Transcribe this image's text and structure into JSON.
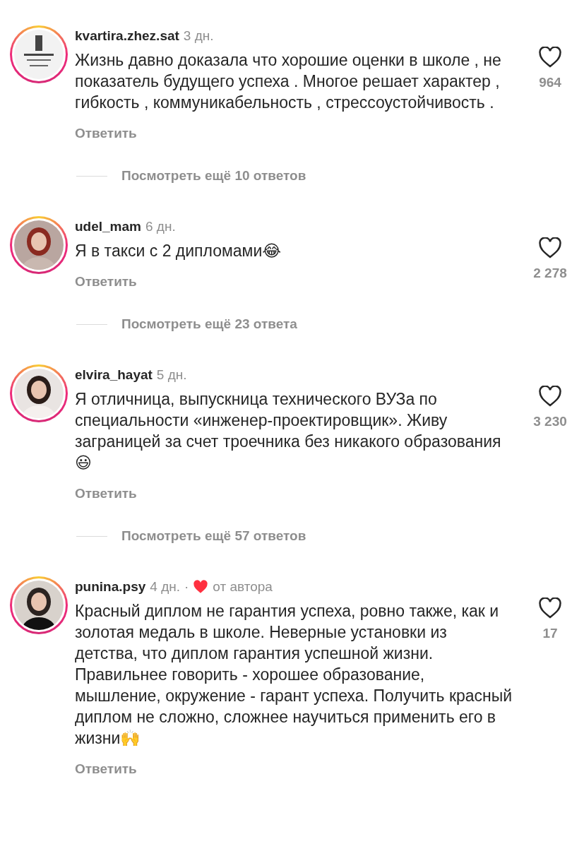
{
  "comments": [
    {
      "username": "kvartira.zhez.sat",
      "time": "3 дн.",
      "text": "Жизнь давно доказала что хорошие оценки в школе , не показатель будущего успеха . Многое решает характер , гибкость , коммуникабельность , стрессоустойчивость .",
      "liked": false,
      "likes": "964",
      "reply": "Ответить",
      "more_replies": "Посмотреть ещё 10 ответов"
    },
    {
      "username": "udel_mam",
      "time": "6 дн.",
      "text": "Я в такси с 2 дипломами😂",
      "liked": false,
      "likes": "2 278",
      "reply": "Ответить",
      "more_replies": "Посмотреть ещё 23 ответа"
    },
    {
      "username": "elvira_hayat",
      "time": "5 дн.",
      "text": "Я отличница, выпускница технического ВУЗа по специальности «инженер-проектировщик». Живу заграницей за счет троечника без никакого образования 😃",
      "liked": false,
      "likes": "3 230",
      "reply": "Ответить",
      "more_replies": "Посмотреть ещё 57 ответов"
    },
    {
      "username": "punina.psy",
      "time": "4 дн.",
      "separator": "·",
      "author_like": "от автора",
      "text": "Красный диплом не гарантия успеха, ровно также, как и золотая медаль в школе. Неверные установки из детства, что диплом гарантия успешной жизни. Правильнее говорить - хорошее образование, мышление, окружение - гарант успеха. Получить красный диплом не сложно, сложнее научиться применить его в жизни🙌",
      "liked": false,
      "likes": "17",
      "reply": "Ответить"
    }
  ]
}
